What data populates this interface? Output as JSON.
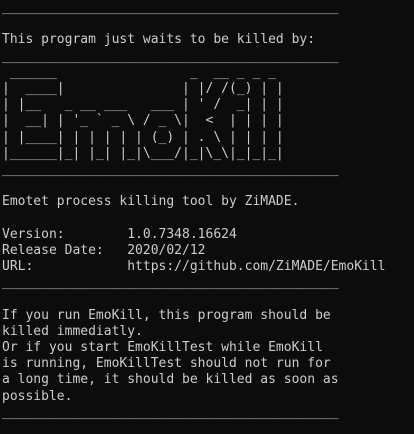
{
  "console": {
    "rule": "___________________________________________",
    "intro": "This program just waits to be killed by:",
    "banner": [
      " ______                 _  __ _ _ _",
      "|  ____|               | |/ /(_) | |",
      "| |__   _ __ ___   ___ | ' /  _| | |",
      "|  __| | '_ ` _ \\ / _ \\|  <  | | | |",
      "| |____| | | | | | (_) | . \\ | | | |",
      "|______|_| |_| |_|\\___/|_|\\_\\|_|_|_|"
    ],
    "description": "Emotet process killing tool by ZiMADE.",
    "version_line": "Version:        1.0.7348.16624",
    "release_line": "Release Date:   2020/02/12",
    "url_line": "URL:            https://github.com/ZiMADE/EmoKill",
    "message_lines": [
      "If you run EmoKill, this program should be",
      "killed immediatly.",
      "Or if you start EmoKillTest while EmoKill",
      "is running, EmoKillTest should not run for",
      "a long time, it should be killed as soon as",
      "possible."
    ]
  }
}
